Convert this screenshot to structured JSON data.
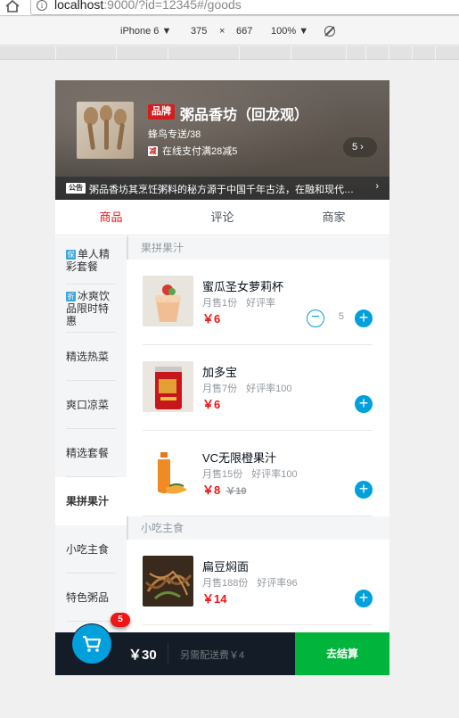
{
  "browser": {
    "url_host": "localhost",
    "url_rest": ":9000/?id=12345#/goods",
    "device": "iPhone 6",
    "width": "375",
    "times": "×",
    "height": "667",
    "zoom": "100%"
  },
  "seller": {
    "brand_badge": "品牌",
    "name": "粥品香坊（回龙观）",
    "delivery": "蜂鸟专送/38",
    "discount_icon": "减",
    "discount": "在线支付满28减5",
    "promo_count": "5 ›",
    "notice_tag": "公告",
    "notice": "粥品香坊其烹饪粥料的秘方源于中国千年古法，在融和现代制作工艺",
    "notice_arrow": "›"
  },
  "tabs": [
    {
      "label": "商品"
    },
    {
      "label": "评论"
    },
    {
      "label": "商家"
    }
  ],
  "menu": [
    {
      "icon": "保",
      "label": "单人精彩套餐"
    },
    {
      "icon": "折",
      "label": "冰爽饮品限时特惠"
    },
    {
      "label": "精选热菜"
    },
    {
      "label": "爽口凉菜"
    },
    {
      "label": "精选套餐"
    },
    {
      "label": "果拼果汁"
    },
    {
      "label": "小吃主食"
    },
    {
      "label": "特色粥品"
    }
  ],
  "sections": [
    {
      "title": "果拼果汁",
      "foods": [
        {
          "name": "蜜瓜圣女萝莉杯",
          "sales": "月售1份",
          "rating": "好评率",
          "price": "￥6",
          "count": "5"
        },
        {
          "name": "加多宝",
          "sales": "月售7份",
          "rating": "好评率100",
          "price": "￥6"
        },
        {
          "name": "VC无限橙果汁",
          "sales": "月售15份",
          "rating": "好评率100",
          "price": "￥8",
          "old_price": "￥10"
        }
      ]
    },
    {
      "title": "小吃主食",
      "foods": [
        {
          "name": "扁豆焖面",
          "sales": "月售188份",
          "rating": "好评率96",
          "price": "￥14"
        }
      ]
    }
  ],
  "cart": {
    "count": "5",
    "total": "￥30",
    "delivery_fee": "另需配送费￥4",
    "pay": "去结算"
  },
  "colors": {
    "accent": "#00a0dc",
    "price": "#f01414",
    "pay": "#00b43c",
    "cart_bg": "#141d27"
  }
}
